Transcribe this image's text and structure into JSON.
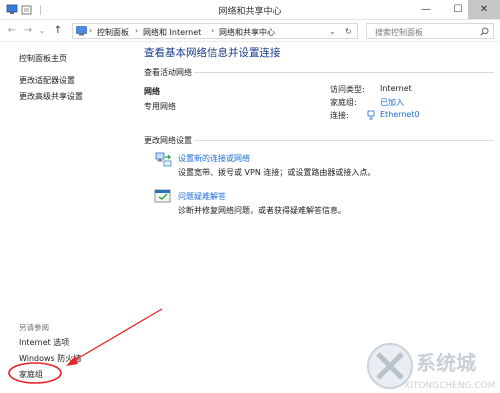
{
  "window": {
    "title": "网络和共享中心",
    "minimize_glyph": "—",
    "maximize_glyph": "☐",
    "close_glyph": "✕"
  },
  "address_bar": {
    "back_glyph": "←",
    "forward_glyph": "→",
    "up_glyph": "↑",
    "breadcrumbs": [
      "控制面板",
      "网络和 Internet",
      "网络和共享中心"
    ],
    "separator": "›",
    "dropdown_glyph": "⌄",
    "refresh_glyph": "↻",
    "search_placeholder": "搜索控制面板"
  },
  "sidebar": {
    "home_link": "控制面板主页",
    "links": [
      "更改适配器设置",
      "更改高级共享设置"
    ],
    "see_also_label": "另请参阅",
    "see_also_links": [
      "Internet 选项",
      "Windows 防火墙",
      "家庭组"
    ]
  },
  "main": {
    "heading": "查看基本网络信息并设置连接",
    "active_networks_label": "查看活动网络",
    "network": {
      "name": "网络",
      "type": "专用网络",
      "access_type_label": "访问类型:",
      "access_type_value": "Internet",
      "homegroup_label": "家庭组:",
      "homegroup_value": "已加入",
      "connections_label": "连接:",
      "connections_value": "Ethernet0"
    },
    "change_settings_label": "更改网络设置",
    "tasks": [
      {
        "title": "设置新的连接或网络",
        "description": "设置宽带、拨号或 VPN 连接；或设置路由器或接入点。",
        "icon": "network-setup-icon"
      },
      {
        "title": "问题疑难解答",
        "description": "诊断并修复网络问题，或者获得疑难解答信息。",
        "icon": "troubleshoot-icon"
      }
    ]
  },
  "colors": {
    "link": "#1a6ed8",
    "heading": "#1a3c8c",
    "annotation": "#e8242a"
  },
  "annotation": {
    "type": "red circle and arrow highlighting 家庭组"
  },
  "watermark": {
    "logo_text": "系统城",
    "url_text": "XITONGCHENG.COM"
  }
}
